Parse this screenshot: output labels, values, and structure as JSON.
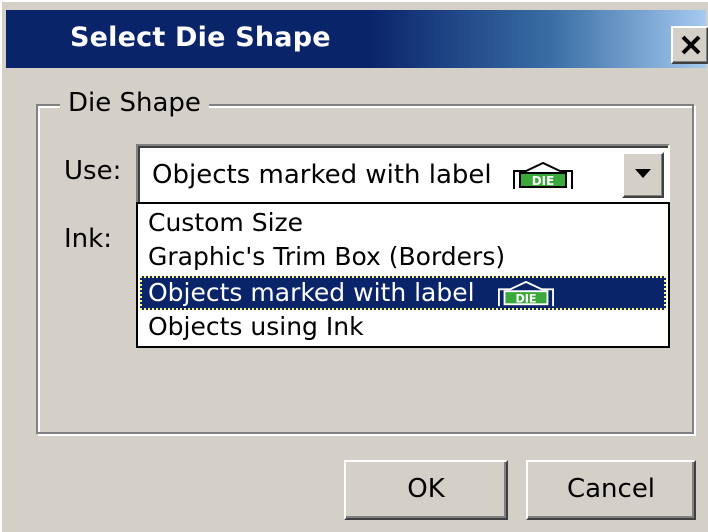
{
  "window": {
    "title": "Select Die Shape",
    "close_icon": "close-x-icon"
  },
  "group": {
    "legend": "Die Shape"
  },
  "use_field": {
    "label": "Use:",
    "value": "Objects marked with label",
    "value_badge": "DIE"
  },
  "ink_field": {
    "label": "Ink:"
  },
  "dropdown": {
    "items": [
      {
        "label": "Custom Size",
        "badge": ""
      },
      {
        "label": "Graphic's Trim Box (Borders)",
        "badge": ""
      },
      {
        "label": "Objects marked with label",
        "badge": "DIE",
        "selected": true
      },
      {
        "label": "Objects using Ink",
        "badge": ""
      }
    ]
  },
  "buttons": {
    "ok": "OK",
    "cancel": "Cancel"
  },
  "colors": {
    "title_bar": "#0a246a",
    "selection": "#0a246a",
    "badge_green": "#2e8b2e",
    "face": "#d4d0c8"
  }
}
